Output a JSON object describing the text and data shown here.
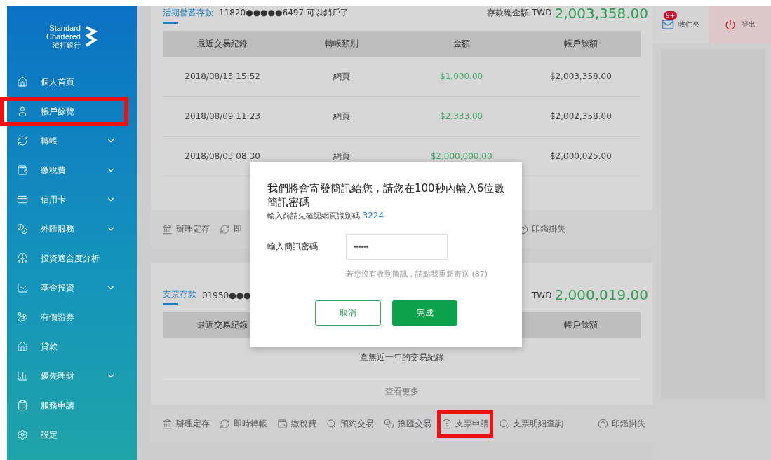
{
  "brand": {
    "name_line_1": "Standard",
    "name_line_2": "Chartered",
    "name_local": "渣打銀行"
  },
  "sidebar": {
    "items": [
      {
        "label": "個人首頁",
        "expandable": false,
        "highlighted": false
      },
      {
        "label": "帳戶餘覽",
        "expandable": false,
        "highlighted": true
      },
      {
        "label": "轉帳",
        "expandable": true,
        "highlighted": false
      },
      {
        "label": "繳稅費",
        "expandable": true,
        "highlighted": false
      },
      {
        "label": "信用卡",
        "expandable": true,
        "highlighted": false
      },
      {
        "label": "外匯服務",
        "expandable": true,
        "highlighted": false
      },
      {
        "label": "投資適合度分析",
        "expandable": false,
        "highlighted": false
      },
      {
        "label": "基金投資",
        "expandable": true,
        "highlighted": false
      },
      {
        "label": "有價證券",
        "expandable": false,
        "highlighted": false
      },
      {
        "label": "貸款",
        "expandable": false,
        "highlighted": false
      },
      {
        "label": "優先理財",
        "expandable": true,
        "highlighted": false
      },
      {
        "label": "服務申請",
        "expandable": false,
        "highlighted": false
      },
      {
        "label": "設定",
        "expandable": false,
        "highlighted": false
      }
    ]
  },
  "accounts": [
    {
      "type": "活期儲蓄存款",
      "number": "11820●●●●●6497 可以銷戶了",
      "total_label": "存款總金額 TWD",
      "total": "2,003,358.00",
      "columns": [
        "最近交易紀錄",
        "轉帳類別",
        "金額",
        "帳戶餘額"
      ],
      "rows": [
        [
          "2018/08/15 15:52",
          "網頁",
          "$1,000.00",
          "$2,003,358.00"
        ],
        [
          "2018/08/09 11:23",
          "網頁",
          "$2,333.00",
          "$2,002,358.00"
        ],
        [
          "2018/08/03 08:30",
          "網頁",
          "$2,000,000.00",
          "$2,000,025.00"
        ]
      ],
      "actions": [
        {
          "label": "辦理定存",
          "highlighted": false
        },
        {
          "label": "即",
          "highlighted": false
        },
        {
          "label": "印鑑掛失",
          "highlighted": false
        }
      ]
    },
    {
      "type": "支票存款",
      "number": "01950●●●",
      "total_label": "TWD",
      "total": "2,000,019.00",
      "columns": [
        "最近交易紀錄",
        null,
        null,
        "帳戶餘額"
      ],
      "empty_message": "查無近一年的交易紀錄",
      "more_link": "查看更多",
      "actions": [
        {
          "label": "辦理定存",
          "highlighted": false
        },
        {
          "label": "即時轉帳",
          "highlighted": false
        },
        {
          "label": "繳稅費",
          "highlighted": false
        },
        {
          "label": "預約交易",
          "highlighted": false
        },
        {
          "label": "換匯交易",
          "highlighted": false
        },
        {
          "label": "支票申請",
          "highlighted": true
        },
        {
          "label": "支票明細查詢",
          "highlighted": false
        },
        {
          "label": "印鑑掛失",
          "highlighted": false
        }
      ]
    }
  ],
  "header": {
    "inbox_label": "收件夾",
    "inbox_badge": "9+",
    "logout_label": "登出"
  },
  "dialog": {
    "title": "我們將會寄發簡訊給您，請您在100秒內輸入6位數簡訊密碼",
    "subtitle": "輸入前請先確認網頁識別碼",
    "page_code": "3224",
    "field_label": "輸入簡訊密碼",
    "field_value": "••••••",
    "resend_hint": "若您沒有收到簡訊，請點我重新寄送 (87)",
    "cancel_label": "取消",
    "confirm_label": "完成"
  }
}
